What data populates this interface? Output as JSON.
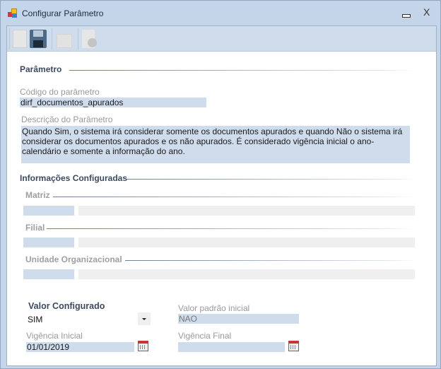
{
  "window": {
    "title": "Configurar Parâmetro",
    "close_glyph": "X"
  },
  "toolbar": {
    "buttons": [
      "new-icon",
      "save-icon",
      "lock-icon",
      "delete-icon"
    ]
  },
  "parametro": {
    "section": "Parâmetro",
    "codigo_label": "Código do parâmetro",
    "codigo_value": "dirf_documentos_apurados",
    "descricao_label": "Descrição do Parâmetro",
    "descricao_value": "Quando Sim, o sistema irá considerar somente os documentos apurados e quando Não o sistema irá considerar os documentos apurados e os não apurados. É considerado vigência inicial o ano-calendário e somente a informação do ano."
  },
  "info": {
    "section": "Informações Configuradas",
    "matriz": "Matriz",
    "filial": "Filial",
    "unidade": "Unidade Organizacional"
  },
  "valor": {
    "label": "Valor Configurado",
    "selected": "SIM",
    "padrao_label": "Valor padrão inicial",
    "padrao_value": "NAO",
    "vig_ini_label": "Vigência Inicial",
    "vig_ini_value": "01/01/2019",
    "vig_fim_label": "Vigência Final",
    "vig_fim_value": ""
  }
}
